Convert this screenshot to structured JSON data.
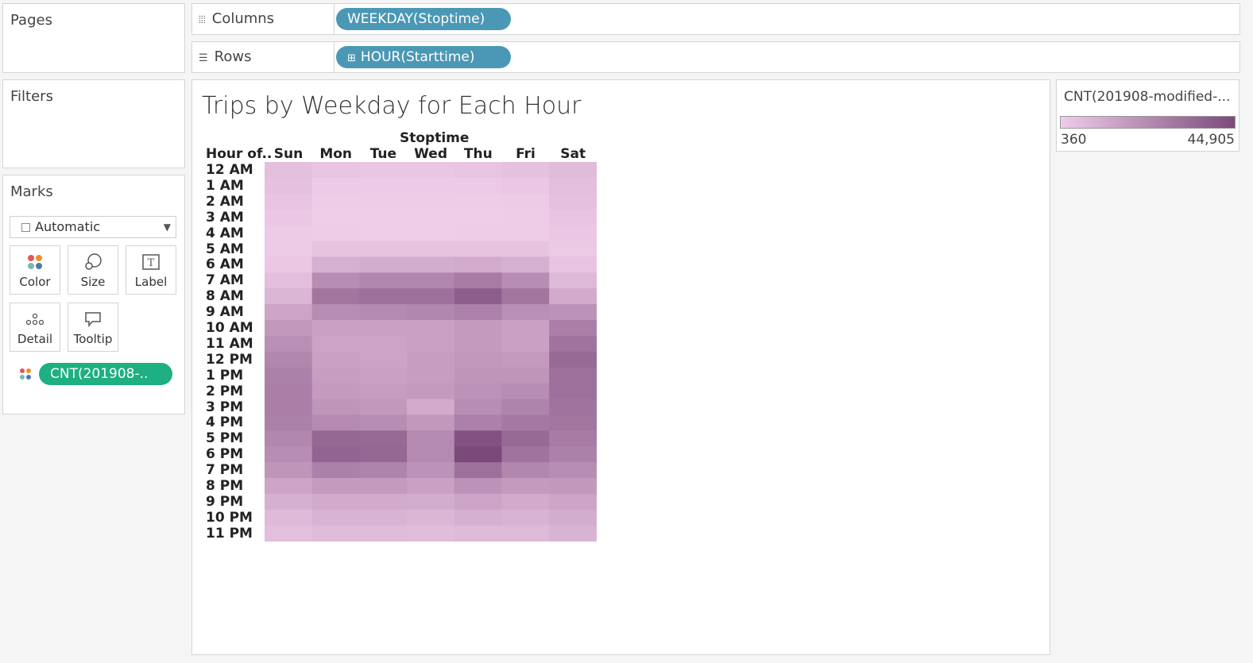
{
  "pages_label": "Pages",
  "filters_label": "Filters",
  "marks_label": "Marks",
  "columns": {
    "label": "Columns",
    "pill": "WEEKDAY(Stoptime)"
  },
  "rows": {
    "label": "Rows",
    "pill": "HOUR(Starttime)"
  },
  "marks": {
    "type": "Automatic",
    "buttons": {
      "color": "Color",
      "size": "Size",
      "label": "Label",
      "detail": "Detail",
      "tooltip": "Tooltip"
    },
    "field_pill": "CNT(201908-.."
  },
  "legend": {
    "title": "CNT(201908-modified-...",
    "min": "360",
    "max": "44,905"
  },
  "colors": {
    "low": "#efcce8",
    "high": "#7b4a7b",
    "pill_blue": "#4a98b5",
    "pill_green": "#1eaf82"
  },
  "chart_data": {
    "type": "heatmap",
    "title": "Trips by Weekday for Each Hour",
    "column_title": "Stoptime",
    "row_header": "Hour of..",
    "columns": [
      "Sun",
      "Mon",
      "Tue",
      "Wed",
      "Thu",
      "Fri",
      "Sat"
    ],
    "rows": [
      "12 AM",
      "1 AM",
      "2 AM",
      "3 AM",
      "4 AM",
      "5 AM",
      "6 AM",
      "7 AM",
      "8 AM",
      "9 AM",
      "10 AM",
      "11 AM",
      "12 PM",
      "1 PM",
      "2 PM",
      "3 PM",
      "4 PM",
      "5 PM",
      "6 PM",
      "7 PM",
      "8 PM",
      "9 PM",
      "10 PM",
      "11 PM"
    ],
    "value_range": [
      360,
      44905
    ],
    "values": [
      [
        5000,
        3000,
        2500,
        2500,
        3000,
        4000,
        6000
      ],
      [
        4000,
        1500,
        1200,
        1200,
        1500,
        2000,
        5000
      ],
      [
        3000,
        800,
        600,
        600,
        800,
        1200,
        4000
      ],
      [
        2000,
        500,
        400,
        400,
        500,
        800,
        3000
      ],
      [
        1200,
        600,
        500,
        500,
        600,
        800,
        2000
      ],
      [
        1000,
        3500,
        3500,
        3500,
        3500,
        3500,
        1500
      ],
      [
        2000,
        10000,
        11000,
        11000,
        12000,
        10000,
        3000
      ],
      [
        5000,
        22000,
        24000,
        24000,
        28000,
        22000,
        7000
      ],
      [
        8000,
        30000,
        32000,
        32000,
        38000,
        30000,
        12000
      ],
      [
        14000,
        22000,
        23000,
        24000,
        26000,
        21000,
        20000
      ],
      [
        18000,
        15000,
        15000,
        15000,
        17000,
        15000,
        27000
      ],
      [
        21000,
        14000,
        14000,
        15000,
        17000,
        15000,
        31000
      ],
      [
        24000,
        15000,
        14000,
        16000,
        18000,
        17000,
        34000
      ],
      [
        26000,
        16000,
        15000,
        16000,
        19000,
        19000,
        32000
      ],
      [
        27000,
        17000,
        16000,
        17000,
        20000,
        22000,
        32000
      ],
      [
        27000,
        19000,
        18000,
        12000,
        22000,
        25000,
        31000
      ],
      [
        26000,
        23000,
        22000,
        18000,
        26000,
        29000,
        30000
      ],
      [
        24000,
        35000,
        34000,
        23000,
        42000,
        34000,
        28000
      ],
      [
        22000,
        36000,
        35000,
        23000,
        44905,
        31000,
        26000
      ],
      [
        19000,
        26000,
        25000,
        20000,
        32000,
        24000,
        22000
      ],
      [
        14000,
        17000,
        17000,
        15000,
        20000,
        17000,
        18000
      ],
      [
        10000,
        12000,
        12000,
        11000,
        14000,
        12000,
        14000
      ],
      [
        7000,
        9000,
        9000,
        8000,
        10000,
        9000,
        11000
      ],
      [
        5000,
        6000,
        6000,
        5500,
        7000,
        7000,
        9000
      ]
    ]
  }
}
